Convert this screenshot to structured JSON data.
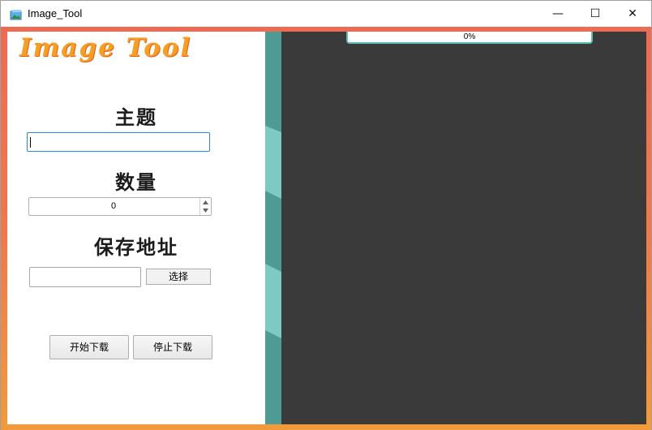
{
  "window": {
    "title": "Image_Tool",
    "minimize_glyph": "—",
    "maximize_glyph": "☐",
    "close_glyph": "✕"
  },
  "app": {
    "logo_text": "Image Tool"
  },
  "form": {
    "topic_label": "主题",
    "topic_value": "",
    "count_label": "数量",
    "count_value": "0",
    "path_label": "保存地址",
    "path_value": "",
    "choose_label": "选择",
    "start_label": "开始下载",
    "stop_label": "停止下载"
  },
  "progress": {
    "value": 0,
    "text": "0%"
  },
  "colors": {
    "frame_top": "#ef6a52",
    "frame_bottom": "#f29a3a",
    "divider": "#4d9b93",
    "divider_light": "#7ccac1",
    "right_panel": "#3a3a3a",
    "progress_accent": "#5fbdb0",
    "logo": "#f5a022",
    "input_focus": "#2b8ad6"
  },
  "icons": {
    "app": "image-tool-icon",
    "spin_up": "triangle-up-icon",
    "spin_down": "triangle-down-icon"
  }
}
